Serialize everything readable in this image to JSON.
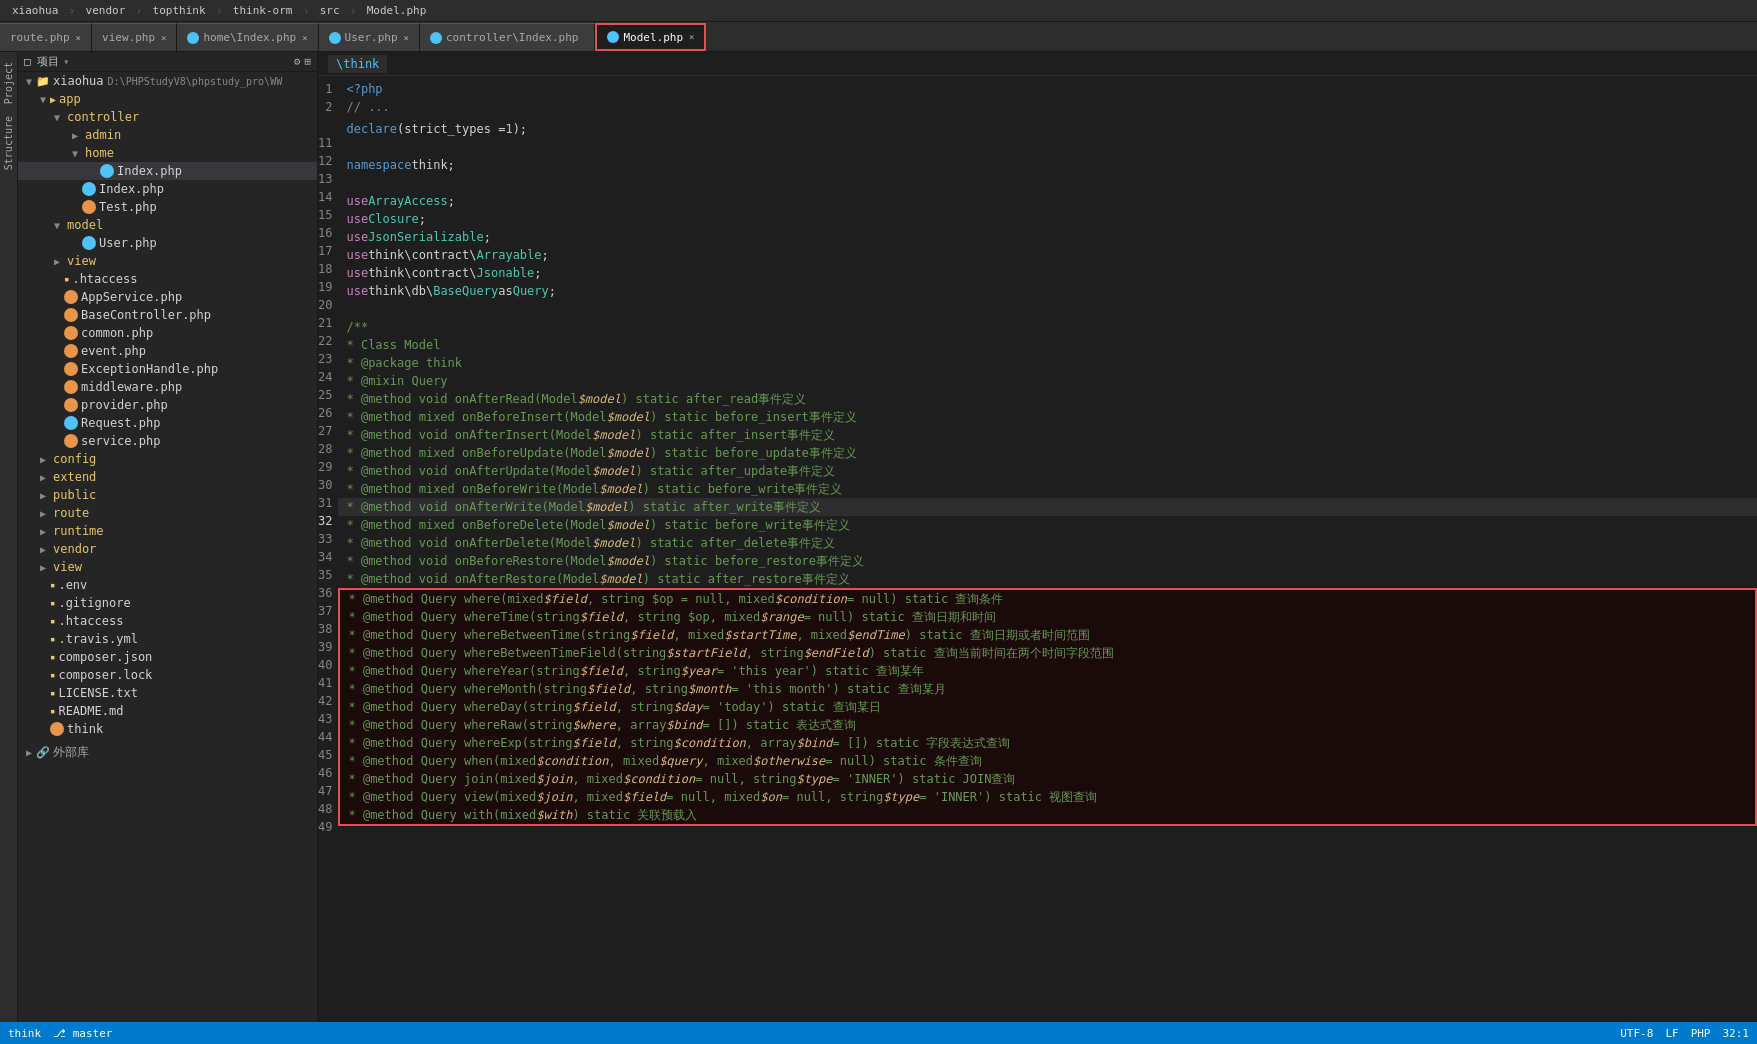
{
  "topbar": {
    "items": [
      "xiaohua",
      "vendor",
      "topthink",
      "think-orm",
      "src",
      "Model.php"
    ]
  },
  "tabs": [
    {
      "id": "route",
      "label": "route.php",
      "icon": "none",
      "active": false,
      "modified": true
    },
    {
      "id": "view",
      "label": "view.php",
      "icon": "none",
      "active": false,
      "modified": true
    },
    {
      "id": "home-index",
      "label": "home\\Index.php",
      "icon": "blue",
      "active": false,
      "modified": false
    },
    {
      "id": "user",
      "label": "User.php",
      "icon": "blue",
      "active": false,
      "modified": true
    },
    {
      "id": "controller-index",
      "label": "controller\\Index.php",
      "icon": "blue",
      "active": false,
      "modified": false
    },
    {
      "id": "model",
      "label": "Model.php",
      "icon": "blue",
      "active": true,
      "modified": true
    }
  ],
  "breadcrumb": "\\think",
  "toolbar": {
    "project_label": "□ 项目",
    "icons": [
      "⚙",
      "⊞"
    ]
  },
  "filetree": {
    "root": "xiaohua",
    "root_path": "D:\\PHPStudyV8\\phpstudy_pro\\WW",
    "items": [
      {
        "indent": 1,
        "type": "folder",
        "label": "app",
        "open": true
      },
      {
        "indent": 2,
        "type": "folder",
        "label": "controller",
        "open": true
      },
      {
        "indent": 3,
        "type": "folder",
        "label": "admin",
        "open": false
      },
      {
        "indent": 3,
        "type": "folder",
        "label": "home",
        "open": true
      },
      {
        "indent": 4,
        "type": "file",
        "label": "Index.php",
        "icon": "blue",
        "selected": true
      },
      {
        "indent": 3,
        "type": "file",
        "label": "Index.php",
        "icon": "blue"
      },
      {
        "indent": 3,
        "type": "file",
        "label": "Test.php",
        "icon": "orange"
      },
      {
        "indent": 2,
        "type": "folder",
        "label": "model",
        "open": true
      },
      {
        "indent": 3,
        "type": "file",
        "label": "User.php",
        "icon": "blue"
      },
      {
        "indent": 2,
        "type": "folder",
        "label": "view",
        "open": false
      },
      {
        "indent": 2,
        "type": "file",
        "label": ".htaccess",
        "icon": "yellow-file"
      },
      {
        "indent": 2,
        "type": "file",
        "label": "AppService.php",
        "icon": "orange"
      },
      {
        "indent": 2,
        "type": "file",
        "label": "BaseController.php",
        "icon": "orange"
      },
      {
        "indent": 2,
        "type": "file",
        "label": "common.php",
        "icon": "orange"
      },
      {
        "indent": 2,
        "type": "file",
        "label": "event.php",
        "icon": "orange"
      },
      {
        "indent": 2,
        "type": "file",
        "label": "ExceptionHandle.php",
        "icon": "orange"
      },
      {
        "indent": 2,
        "type": "file",
        "label": "middleware.php",
        "icon": "orange"
      },
      {
        "indent": 2,
        "type": "file",
        "label": "provider.php",
        "icon": "orange"
      },
      {
        "indent": 2,
        "type": "file",
        "label": "Request.php",
        "icon": "blue"
      },
      {
        "indent": 2,
        "type": "file",
        "label": "service.php",
        "icon": "orange"
      },
      {
        "indent": 1,
        "type": "folder",
        "label": "config",
        "open": false
      },
      {
        "indent": 1,
        "type": "folder",
        "label": "extend",
        "open": false
      },
      {
        "indent": 1,
        "type": "folder",
        "label": "public",
        "open": false
      },
      {
        "indent": 1,
        "type": "folder",
        "label": "route",
        "open": false
      },
      {
        "indent": 1,
        "type": "folder",
        "label": "runtime",
        "open": false
      },
      {
        "indent": 1,
        "type": "folder",
        "label": "vendor",
        "open": false
      },
      {
        "indent": 1,
        "type": "folder",
        "label": "view",
        "open": false
      },
      {
        "indent": 1,
        "type": "file",
        "label": ".env",
        "icon": "yellow-file"
      },
      {
        "indent": 1,
        "type": "file",
        "label": ".gitignore",
        "icon": "yellow-file"
      },
      {
        "indent": 1,
        "type": "file",
        "label": ".htaccess",
        "icon": "yellow-file"
      },
      {
        "indent": 1,
        "type": "file",
        "label": ".travis.yml",
        "icon": "yellow-file"
      },
      {
        "indent": 1,
        "type": "file",
        "label": "composer.json",
        "icon": "yellow-file"
      },
      {
        "indent": 1,
        "type": "file",
        "label": "composer.lock",
        "icon": "yellow-file"
      },
      {
        "indent": 1,
        "type": "file",
        "label": "LICENSE.txt",
        "icon": "yellow-file"
      },
      {
        "indent": 1,
        "type": "file",
        "label": "README.md",
        "icon": "yellow-file"
      },
      {
        "indent": 1,
        "type": "file",
        "label": "think",
        "icon": "orange"
      }
    ]
  },
  "code": {
    "lines": [
      {
        "num": 1,
        "content": "<?php",
        "type": "normal"
      },
      {
        "num": 2,
        "content": "// ...",
        "type": "comment"
      },
      {
        "num": 11,
        "content": "declare (strict_types = 1);",
        "type": "normal"
      },
      {
        "num": 12,
        "content": "",
        "type": "normal"
      },
      {
        "num": 13,
        "content": "namespace think;",
        "type": "normal"
      },
      {
        "num": 14,
        "content": "",
        "type": "normal"
      },
      {
        "num": 15,
        "content": "use ArrayAccess;",
        "type": "use"
      },
      {
        "num": 16,
        "content": "use Closure;",
        "type": "use"
      },
      {
        "num": 17,
        "content": "use JsonSerializable;",
        "type": "use"
      },
      {
        "num": 18,
        "content": "use think\\contract\\Arrayable;",
        "type": "use"
      },
      {
        "num": 19,
        "content": "use think\\contract\\Jsonable;",
        "type": "use"
      },
      {
        "num": 20,
        "content": "use think\\db\\BaseQuery as Query;",
        "type": "use"
      },
      {
        "num": 21,
        "content": "",
        "type": "normal"
      },
      {
        "num": 22,
        "content": "/**",
        "type": "comment"
      },
      {
        "num": 23,
        "content": " * Class Model",
        "type": "comment"
      },
      {
        "num": 24,
        "content": " * @package think",
        "type": "comment"
      },
      {
        "num": 25,
        "content": " * @mixin Query",
        "type": "comment"
      },
      {
        "num": 26,
        "content": " * @method void onAfterRead(Model $model) static after_read事件定义",
        "type": "comment"
      },
      {
        "num": 27,
        "content": " * @method mixed onBeforeInsert(Model $model) static before_insert事件定义",
        "type": "comment"
      },
      {
        "num": 28,
        "content": " * @method void onAfterInsert(Model $model) static after_insert事件定义",
        "type": "comment"
      },
      {
        "num": 29,
        "content": " * @method mixed onBeforeUpdate(Model $model) static before_update事件定义",
        "type": "comment"
      },
      {
        "num": 30,
        "content": " * @method void onAfterUpdate(Model $model) static after_update事件定义",
        "type": "comment"
      },
      {
        "num": 31,
        "content": " * @method mixed onBeforeWrite(Model $model) static before_write事件定义",
        "type": "comment"
      },
      {
        "num": 32,
        "content": " * @method void onAfterWrite(Model $model) static after_write事件定义",
        "type": "comment",
        "highlighted": true
      },
      {
        "num": 33,
        "content": " * @method mixed onBeforeDelete(Model $model) static before_write事件定义",
        "type": "comment"
      },
      {
        "num": 34,
        "content": " * @method void onAfterDelete(Model $model) static after_delete事件定义",
        "type": "comment"
      },
      {
        "num": 35,
        "content": " * @method void onBeforeRestore(Model $model) static before_restore事件定义",
        "type": "comment"
      },
      {
        "num": 36,
        "content": " * @method void onAfterRestore(Model $model) static after_restore事件定义",
        "type": "comment"
      },
      {
        "num": 37,
        "content": " * @method Query where(mixed $field, string $op = null, mixed $condition = null) static 查询条件",
        "type": "comment-red"
      },
      {
        "num": 38,
        "content": " * @method Query whereTime(string $field, string $op, mixed $range = null) static 查询日期和时间",
        "type": "comment-red"
      },
      {
        "num": 39,
        "content": " * @method Query whereBetweenTime(string $field, mixed $startTime, mixed $endTime) static 查询日期或者时间范围",
        "type": "comment-red"
      },
      {
        "num": 40,
        "content": " * @method Query whereBetweenTimeField(string $startField, string $endField) static 查询当前时间在两个时间字段范围",
        "type": "comment-red"
      },
      {
        "num": 41,
        "content": " * @method Query whereYear(string $field, string $year = 'this year') static 查询某年",
        "type": "comment-red"
      },
      {
        "num": 42,
        "content": " * @method Query whereMonth(string $field, string $month = 'this month') static 查询某月",
        "type": "comment-red"
      },
      {
        "num": 43,
        "content": " * @method Query whereDay(string $field, string $day = 'today') static 查询某日",
        "type": "comment-red"
      },
      {
        "num": 44,
        "content": " * @method Query whereRaw(string $where, array $bind = []) static 表达式查询",
        "type": "comment-red"
      },
      {
        "num": 45,
        "content": " * @method Query whereExp(string $field, string $condition, array $bind = []) static 字段表达式查询",
        "type": "comment-red"
      },
      {
        "num": 46,
        "content": " * @method Query when(mixed $condition, mixed $query, mixed $otherwise = null) static 条件查询",
        "type": "comment-red"
      },
      {
        "num": 47,
        "content": " * @method Query join(mixed $join, mixed $condition = null, string $type = 'INNER') static JOIN查询",
        "type": "comment-red"
      },
      {
        "num": 48,
        "content": " * @method Query view(mixed $join, mixed $field = null, mixed $on = null, string $type = 'INNER') static 视图查询",
        "type": "comment-red"
      },
      {
        "num": 49,
        "content": " * @method Query with(mixed $with) static 关联预载入",
        "type": "comment-red"
      }
    ]
  },
  "statusbar": {
    "think_label": "think"
  },
  "colors": {
    "red_border": "#e05252",
    "blue_tab": "#4fc3f7",
    "active_bg": "#1e1e1e"
  }
}
